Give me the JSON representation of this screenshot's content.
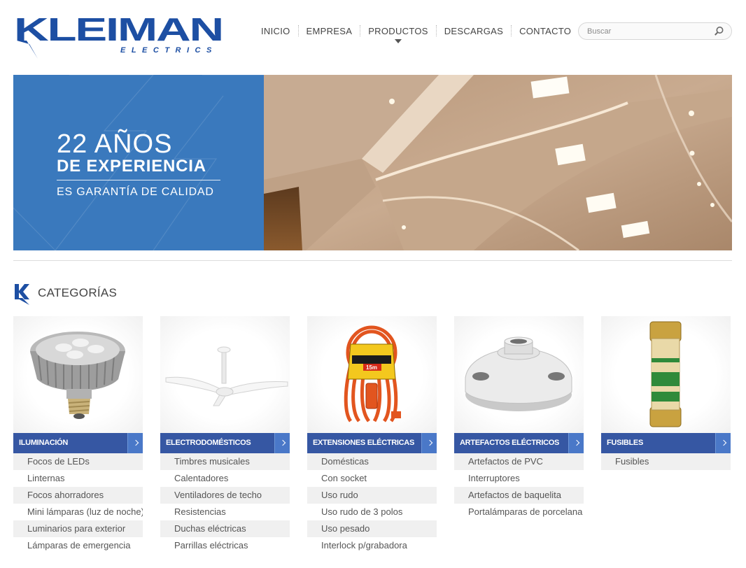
{
  "logo": {
    "brand": "KLEIMAN",
    "tagline": "ELECTRICS",
    "color": "#1d4fa3"
  },
  "nav": {
    "items": [
      {
        "label": "INICIO"
      },
      {
        "label": "EMPRESA"
      },
      {
        "label": "PRODUCTOS"
      },
      {
        "label": "DESCARGAS"
      },
      {
        "label": "CONTACTO"
      }
    ]
  },
  "search": {
    "placeholder": "Buscar"
  },
  "banner": {
    "line1": "22 AÑOS",
    "line2": "DE EXPERIENCIA",
    "line3": "ES GARANTÍA DE CALIDAD",
    "color": "#3a79bd"
  },
  "categories": {
    "title": "CATEGORÍAS",
    "cards": [
      {
        "label": "ILUMINACIÓN",
        "icon": "led-bulb-icon",
        "items": [
          "Focos de LEDs",
          "Linternas",
          "Focos ahorradores",
          "Mini lámparas (luz de noche)",
          "Luminarios para exterior",
          "Lámparas de emergencia"
        ]
      },
      {
        "label": "ELECTRODOMÉSTICOS",
        "icon": "ceiling-fan-icon",
        "items": [
          "Timbres musicales",
          "Calentadores",
          "Ventiladores de techo",
          "Resistencias",
          "Duchas eléctricas",
          "Parrillas eléctricas"
        ]
      },
      {
        "label": "EXTENSIONES ELÉCTRICAS",
        "icon": "extension-cord-icon",
        "items": [
          "Domésticas",
          "Con socket",
          "Uso rudo",
          "Uso rudo de 3 polos",
          "Uso pesado",
          "Interlock p/grabadora"
        ]
      },
      {
        "label": "ARTEFACTOS ELÉCTRICOS",
        "icon": "porcelain-socket-icon",
        "items": [
          "Artefactos de PVC",
          "Interruptores",
          "Artefactos de baquelita",
          "Portalámparas de porcelana"
        ]
      },
      {
        "label": "FUSIBLES",
        "icon": "fuse-icon",
        "items": [
          "Fusibles"
        ]
      }
    ],
    "bar_color": "#3657a3"
  }
}
